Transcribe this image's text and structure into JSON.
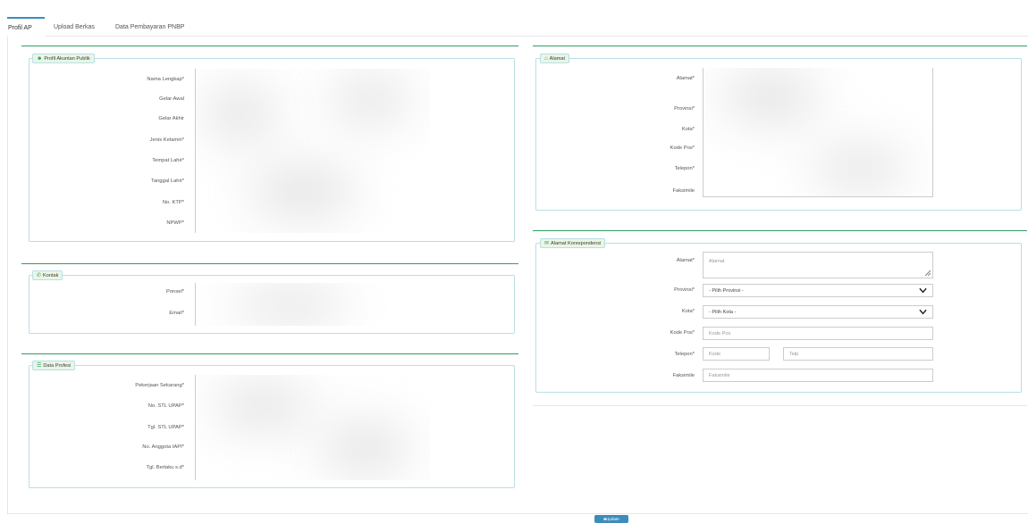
{
  "tabs": [
    "Profil AP",
    "Upload Berkas",
    "Data Pembayaran PNBP"
  ],
  "profil": {
    "legend": "Profil Akuntan Publik",
    "icon": "user-icon",
    "fields": [
      "Nama Lengkap*",
      "Gelar Awal",
      "Gelar Akhir",
      "Jenis Kelamin*",
      "Tempat Lahir*",
      "Tanggal Lahir*",
      "No. KTP*",
      "NPWP*"
    ]
  },
  "kontak": {
    "legend": "Kontak",
    "icon": "phone-icon",
    "fields": [
      "Ponsel*",
      "Email*"
    ]
  },
  "profesi": {
    "legend": "Data Profesi",
    "icon": "list-icon",
    "fields": [
      "Pekerjaan Sekarang*",
      "No. STL UPAP*",
      "Tgl. STL UPAP*",
      "No. Anggota IAPI*",
      "Tgl. Berlaku s.d*"
    ]
  },
  "alamat": {
    "legend": "Alamat",
    "icon": "home-icon",
    "fields": [
      "Alamat*",
      "Provinsi*",
      "Kota*",
      "Kode Pos*",
      "Telepon*",
      "Faksimile"
    ]
  },
  "korespondensi": {
    "legend": "Alamat Korespondensi",
    "icon": "envelope-icon",
    "labels": {
      "alamat": "Alamat*",
      "provinsi": "Provinsi*",
      "kota": "Kota*",
      "kodepos": "Kode Pos*",
      "telepon": "Telepon*",
      "faksimile": "Faksimile"
    },
    "placeholders": {
      "alamat": "Alamat",
      "kodepos": "Kode Pos",
      "kode": "Kode",
      "telp": "Telp",
      "faksimile": "Faksimile"
    },
    "provinsi_selected": "- Pilih Provinsi -",
    "kota_selected": "- Pilih Kota -"
  },
  "update_button": "Update",
  "colors": {
    "accent": "#2e9e63",
    "primary": "#3c8dbc",
    "border": "#b9dfe4",
    "legend_bg": "#eaf6e5"
  }
}
